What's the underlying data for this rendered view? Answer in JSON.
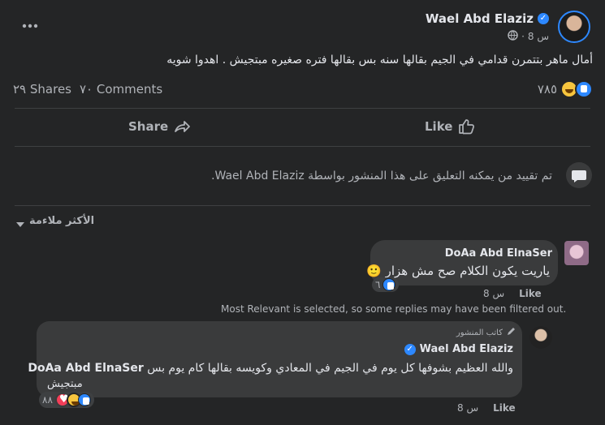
{
  "post": {
    "author": "Wael Abd Elaziz",
    "time": "8 س",
    "separator": "·",
    "text": "أمال ماهر بتتمرن قدامي في الجيم بقالها سنه بس بقالها فتره صغيره مبتجيش . اهدوا شويه",
    "reactions_count": "٧٨٥",
    "comments_count": "٧٠ Comments",
    "shares_count": "٢٩ Shares"
  },
  "actions": {
    "like_label": "Like",
    "share_label": "Share"
  },
  "notice": {
    "text": "تم تقييد من يمكنه التعليق على هذا المنشور بواسطة Wael Abd Elaziz."
  },
  "filter": {
    "label": "الأكثر ملاءمة"
  },
  "comment1": {
    "author": "DoAa Abd ElnaSer",
    "text": "ياريت يكون الكلام صح مش هزار 🙂",
    "reaction_count": "٦",
    "time": "8 س",
    "like_label": "Like"
  },
  "filter_note": "Most Relevant is selected, so some replies may have been filtered out.",
  "reply": {
    "badge": "كاتب المنشور",
    "author": "Wael Abd Elaziz",
    "mention": "DoAa Abd ElnaSer",
    "text_line1": "والله العظيم بشوفها كل يوم في الجيم في المعادي وكويسه بقالها كام يوم بس",
    "text_line2": "مبتجيش",
    "reaction_count": "٨٨",
    "time": "8 س",
    "like_label": "Like"
  },
  "icons": [
    "more-icon",
    "verified-icon",
    "globe-icon",
    "like-reaction-icon",
    "haha-reaction-icon",
    "love-reaction-icon",
    "like-outline-icon",
    "share-arrow-icon",
    "comment-bubble-icon",
    "caret-down-icon",
    "pen-icon"
  ],
  "colors": {
    "accent": "#2d88ff",
    "background": "#242526",
    "bubble": "#3a3b3c"
  }
}
